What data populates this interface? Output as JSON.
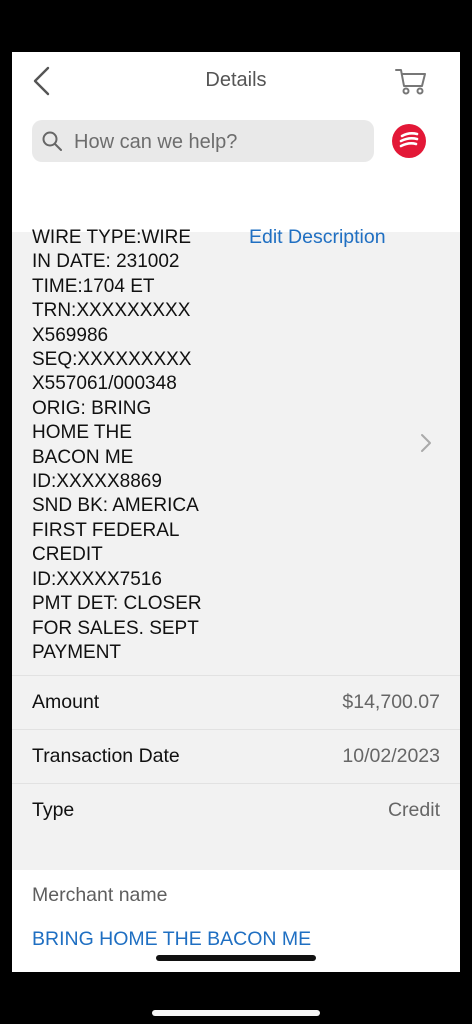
{
  "header": {
    "title": "Details",
    "back_icon": "chevron-left-icon",
    "cart_icon": "cart-icon"
  },
  "search": {
    "placeholder": "How can we help?",
    "icon": "search-icon"
  },
  "brand": {
    "icon": "bank-logo-icon",
    "color": "#e31837"
  },
  "transaction": {
    "description": "WIRE TYPE:WIRE\nIN DATE: 231002\nTIME:1704 ET\nTRN:XXXXXXXXX\nX569986\nSEQ:XXXXXXXXX\nX557061/000348\nORIG: BRING\nHOME THE\nBACON ME\nID:XXXXX8869\nSND BK: AMERICA\nFIRST FEDERAL\nCREDIT\nID:XXXXX7516\nPMT DET: CLOSER\nFOR SALES. SEPT\nPAYMENT",
    "edit_label": "Edit Description",
    "rows": [
      {
        "label": "Amount",
        "value": "$14,700.07"
      },
      {
        "label": "Transaction Date",
        "value": "10/02/2023"
      },
      {
        "label": "Type",
        "value": "Credit"
      }
    ]
  },
  "merchant": {
    "label": "Merchant name",
    "value": "BRING HOME THE BACON ME"
  },
  "colors": {
    "link": "#1f6fc2",
    "background": "#f2f2f2"
  }
}
